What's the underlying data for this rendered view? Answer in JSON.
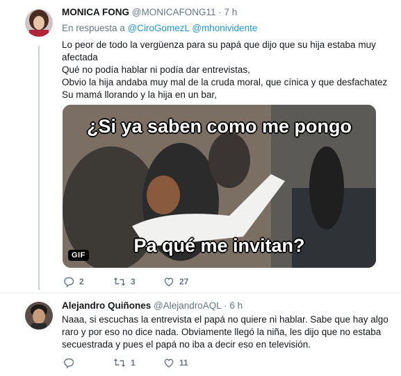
{
  "tweets": [
    {
      "name": "MONICA FONG",
      "handle": "@MONICAFONG11",
      "separator": "·",
      "time": "7 h",
      "reply_prefix": "En respuesta a",
      "reply_mentions": [
        "@CiroGomezL",
        "@mhonividente"
      ],
      "lines": [
        "Lo peor de todo la vergüenza para su papá que dijo que su hija estaba muy",
        "afectada",
        "Qué no podía hablar ni podía dar entrevistas,",
        "Obvio la hija andaba  muy mal  de la cruda moral, que cínica  y que desfachatez",
        "Su mamá llorando  y la hija en un bar,"
      ],
      "media": {
        "top_caption": "¿Si ya saben como me pongo",
        "bottom_caption": "Pa qué me invitan?",
        "badge": "GIF"
      },
      "actions": {
        "replies": "2",
        "retweets": "3",
        "likes": "27"
      }
    },
    {
      "name": "Alejandro Quiñones",
      "handle": "@AlejandroAQL",
      "separator": "·",
      "time": "6 h",
      "lines": [
        "Naaa, si escuchas la entrevista el papá no quiere ni hablar. Sabe que hay algo",
        "raro y por eso no dice nada. Obviamente llegó la niña, les dijo que no estaba",
        "secuestrada y pues el papá no iba a decir eso en televisión."
      ],
      "actions": {
        "replies": "",
        "retweets": "1",
        "likes": "11"
      }
    }
  ],
  "colors": {
    "accent": "#1b95e0",
    "secondary_text": "#657786",
    "divider": "#e6ecf0"
  },
  "icons": [
    "reply-icon",
    "retweet-icon",
    "like-icon"
  ]
}
